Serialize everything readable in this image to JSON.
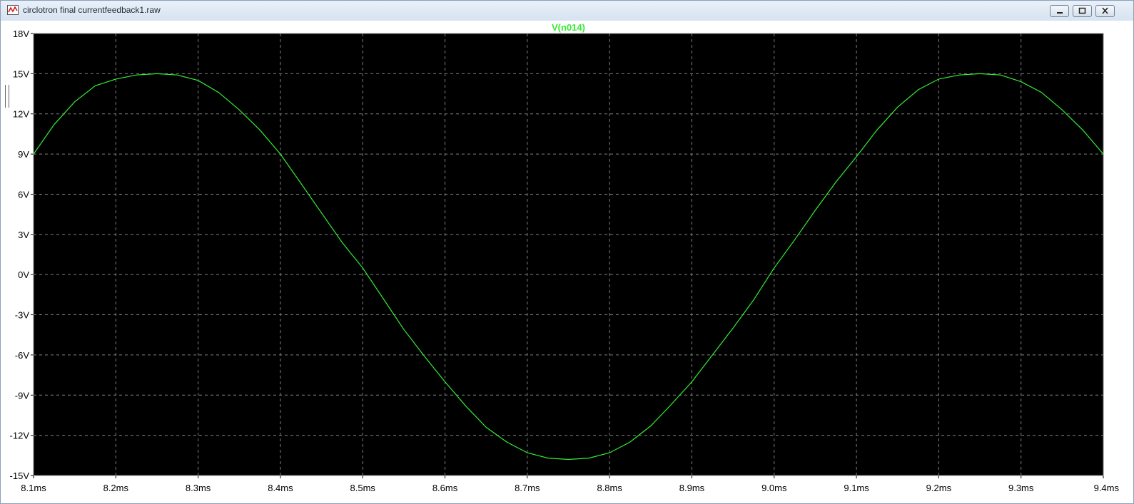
{
  "window": {
    "title": "circlotron final currentfeedback1.raw",
    "buttons": {
      "minimize": "minimize-icon",
      "maximize": "maximize-icon",
      "close": "close-icon"
    }
  },
  "chart_data": {
    "type": "line",
    "series": [
      {
        "name": "V(n014)",
        "color": "#33ee33",
        "x": [
          8.1,
          8.125,
          8.15,
          8.175,
          8.2,
          8.225,
          8.25,
          8.275,
          8.3,
          8.325,
          8.35,
          8.375,
          8.4,
          8.425,
          8.45,
          8.475,
          8.5,
          8.525,
          8.55,
          8.575,
          8.6,
          8.625,
          8.65,
          8.675,
          8.7,
          8.725,
          8.75,
          8.775,
          8.8,
          8.825,
          8.85,
          8.875,
          8.9,
          8.925,
          8.95,
          8.975,
          9.0,
          9.025,
          9.05,
          9.075,
          9.1,
          9.125,
          9.15,
          9.175,
          9.2,
          9.225,
          9.25,
          9.275,
          9.3,
          9.325,
          9.35,
          9.375,
          9.4
        ],
        "y": [
          9.0,
          11.2,
          12.9,
          14.1,
          14.6,
          14.9,
          15.0,
          14.9,
          14.5,
          13.6,
          12.3,
          10.8,
          9.0,
          6.8,
          4.6,
          2.4,
          0.5,
          -1.8,
          -4.1,
          -6.1,
          -8.0,
          -9.8,
          -11.4,
          -12.5,
          -13.3,
          -13.7,
          -13.8,
          -13.7,
          -13.3,
          -12.5,
          -11.3,
          -9.7,
          -8.0,
          -6.0,
          -4.0,
          -1.9,
          0.5,
          2.6,
          4.8,
          6.9,
          8.8,
          10.8,
          12.5,
          13.8,
          14.6,
          14.9,
          15.0,
          14.9,
          14.4,
          13.6,
          12.3,
          10.8,
          9.0
        ]
      }
    ],
    "x_ticks": [
      "8.1ms",
      "8.2ms",
      "8.3ms",
      "8.4ms",
      "8.5ms",
      "8.6ms",
      "8.7ms",
      "8.8ms",
      "8.9ms",
      "9.0ms",
      "9.1ms",
      "9.2ms",
      "9.3ms",
      "9.4ms"
    ],
    "y_ticks": [
      "18V",
      "15V",
      "12V",
      "9V",
      "6V",
      "3V",
      "0V",
      "-3V",
      "-6V",
      "-9V",
      "-12V",
      "-15V"
    ],
    "xlim": [
      8.1,
      9.4
    ],
    "ylim": [
      -15,
      18
    ],
    "grid": true,
    "background": "#000000",
    "grid_color": "#808080"
  }
}
